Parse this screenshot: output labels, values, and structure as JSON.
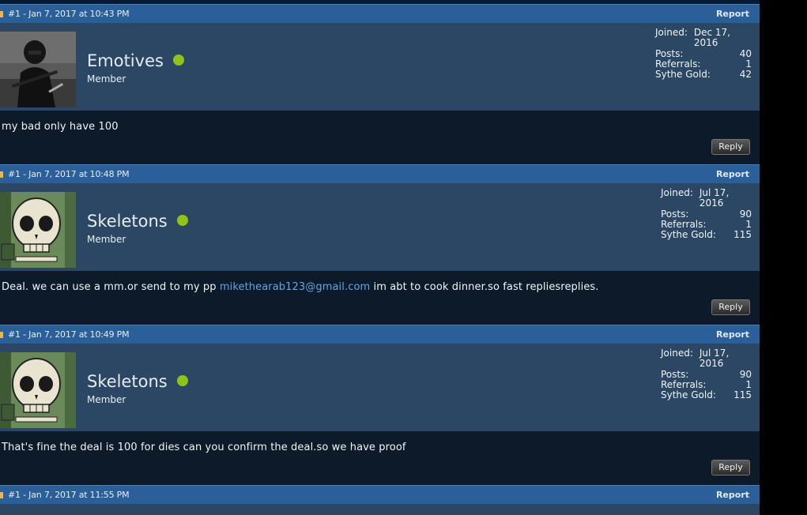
{
  "posts": [
    {
      "header": "#1 - Jan 7, 2017 at 10:43 PM",
      "report": "Report",
      "username": "Emotives",
      "usertitle": "Member",
      "avatar": "masked-figure-avatar",
      "stats": {
        "joined_label": "Joined:",
        "joined": "Dec 17, 2016",
        "posts_label": "Posts:",
        "posts": "40",
        "referrals_label": "Referrals:",
        "referrals": "1",
        "gold_label": "Sythe Gold:",
        "gold": "42"
      },
      "message": "my bad only have 100",
      "reply": "Reply"
    },
    {
      "header": "#1 - Jan 7, 2017 at 10:48 PM",
      "report": "Report",
      "username": "Skeletons",
      "usertitle": "Member",
      "avatar": "skeleton-avatar",
      "stats": {
        "joined_label": "Joined:",
        "joined": "Jul 17, 2016",
        "posts_label": "Posts:",
        "posts": "90",
        "referrals_label": "Referrals:",
        "referrals": "1",
        "gold_label": "Sythe Gold:",
        "gold": "115"
      },
      "message_pre": "Deal. we can use a mm.or send to my pp ",
      "message_link": "mikethearab123@gmail.com",
      "message_post": " im abt to cook dinner.so fast repliesreplies.",
      "reply": "Reply"
    },
    {
      "header": "#1 - Jan 7, 2017 at 10:49 PM",
      "report": "Report",
      "username": "Skeletons",
      "usertitle": "Member",
      "avatar": "skeleton-avatar",
      "stats": {
        "joined_label": "Joined:",
        "joined": "Jul 17, 2016",
        "posts_label": "Posts:",
        "posts": "90",
        "referrals_label": "Referrals:",
        "referrals": "1",
        "gold_label": "Sythe Gold:",
        "gold": "115"
      },
      "message": "That's fine the deal is 100 for dies can you confirm the deal.so we have proof",
      "reply": "Reply"
    },
    {
      "header": "#1 - Jan 7, 2017 at 11:55 PM",
      "report": "Report"
    }
  ],
  "colors": {
    "header_bg": "#2a5f9a",
    "user_bg": "#2c4764",
    "body_bg": "#0c1a29",
    "online": "#8fc319",
    "link": "#62a6e6"
  }
}
